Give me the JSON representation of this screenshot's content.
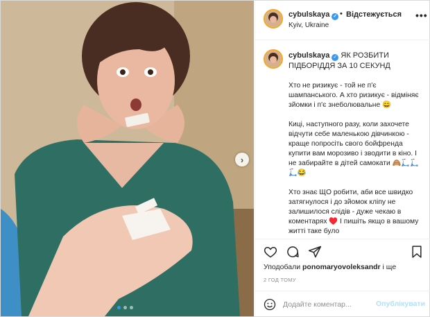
{
  "post": {
    "username": "cybulskaya",
    "verified_symbol": "✓",
    "separator": "•",
    "follow_status": "Відстежується",
    "location": "Kyiv, Ukraine",
    "more_symbol": "•••",
    "next_symbol": "›",
    "carousel": {
      "count": 3,
      "active_index": 0
    }
  },
  "caption": {
    "title": "Як розбити підборіддя за 10 секунд",
    "paragraphs": [
      "Хто не ризикує - той не п'є шампанського. А хто ризикує - відміняє зйомки і п'є знеболювальне 😄",
      "Киці, наступного разу, коли захочете відчути себе маленькою дівчинкою - краще попросіть свого бойфренда купити вам морозиво і зводити в кіно. І не забирайте в дітей самокати 🙈🛴🛴🛴😂",
      "Хто знає ЩО робити, аби все швидко затягнулося і до зйомок кліпу не залишилося слідів - дуже чекаю в коментарях ♥️ І пишіть якщо в вашому житті таке було"
    ]
  },
  "actions": {
    "like_icon": "heart-icon",
    "comment_icon": "comment-bubble-icon",
    "share_icon": "paper-plane-icon",
    "save_icon": "bookmark-icon"
  },
  "likes": {
    "prefix": "Уподобали",
    "user": "ponomaryovoleksandr",
    "suffix": "і ще"
  },
  "timestamp": "2 ГОД ТОМУ",
  "comment": {
    "placeholder": "Додайте коментар...",
    "publish_label": "Опублікувати",
    "emoji_icon": "smiley-icon"
  },
  "colors": {
    "accent": "#3897f0",
    "publish_disabled": "#b2dffc",
    "story_ring": "#f6a623",
    "sweater": "#2f6e62"
  }
}
